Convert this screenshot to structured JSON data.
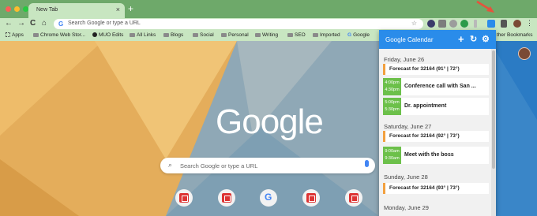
{
  "tab": {
    "title": "New Tab",
    "close": "×",
    "new_tab": "+"
  },
  "toolbar": {
    "back": "←",
    "forward": "→",
    "reload": "C",
    "home": "⌂",
    "omnibox_g": "G",
    "omnibox_placeholder": "Search Google or type a URL",
    "star": "☆"
  },
  "bookmarks": [
    {
      "label": "Apps",
      "icon": "apps-grid-icon"
    },
    {
      "label": "Chrome Web Stor...",
      "icon": "folder-icon"
    },
    {
      "label": "MUO Edits",
      "icon": "muo-icon"
    },
    {
      "label": "All Links",
      "icon": "folder-icon"
    },
    {
      "label": "Blogs",
      "icon": "folder-icon"
    },
    {
      "label": "Social",
      "icon": "folder-icon"
    },
    {
      "label": "Personal",
      "icon": "folder-icon"
    },
    {
      "label": "Writing",
      "icon": "folder-icon"
    },
    {
      "label": "SEO",
      "icon": "folder-icon"
    },
    {
      "label": "Imported",
      "icon": "folder-icon"
    },
    {
      "label": "Google",
      "icon": "google-icon"
    },
    {
      "label": "ther Bookmarks",
      "icon": "folder-icon"
    }
  ],
  "page": {
    "logo": "Google",
    "search_placeholder": "Search Google or type a URL",
    "shortcut_g": "G"
  },
  "calendar": {
    "title": "Google Calendar",
    "add": "+",
    "refresh": "↻",
    "settings": "⚙",
    "days": [
      {
        "date": "Friday, June 26",
        "forecast": "Forecast for 32164 (91° | 72°)",
        "events": [
          {
            "start": "4:00pm",
            "end": "4:30pm",
            "title": "Conference call with San ..."
          },
          {
            "start": "5:00pm",
            "end": "5:30pm",
            "title": "Dr. appointment"
          }
        ]
      },
      {
        "date": "Saturday, June 27",
        "forecast": "Forecast for 32164 (92° | 73°)",
        "events": [
          {
            "start": "9:00am",
            "end": "9:30am",
            "title": "Meet with the boss"
          }
        ]
      },
      {
        "date": "Sunday, June 28",
        "forecast": "Forecast for 32164 (93° | 73°)",
        "events": []
      },
      {
        "date": "Monday, June 29",
        "forecast": "",
        "events": []
      }
    ]
  },
  "colors": {
    "frame": "#6ea96a",
    "toolbar": "#c8e6c1",
    "calendar_header": "#2a8cea",
    "event_time": "#6cc04a",
    "forecast_accent": "#f2a03f",
    "arrow": "#e5533d"
  }
}
